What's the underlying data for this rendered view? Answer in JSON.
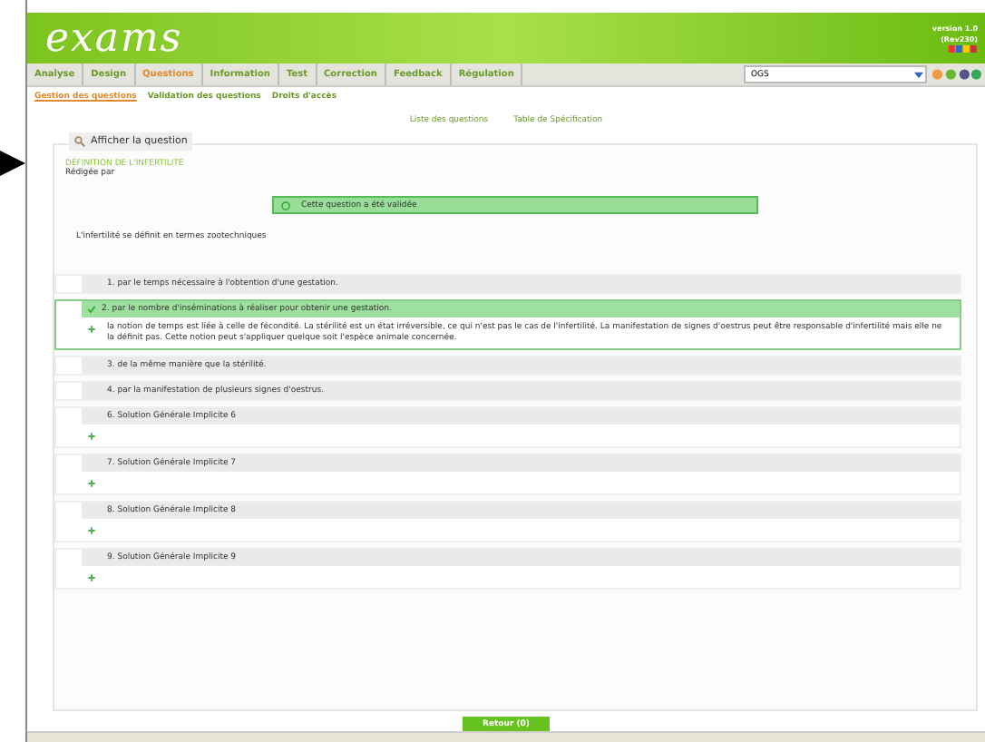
{
  "header": {
    "logo": "exams",
    "version": "version 1.0",
    "revision": "(Rev230)"
  },
  "nav": {
    "tabs": [
      {
        "label": "Analyse",
        "selected": false
      },
      {
        "label": "Design",
        "selected": false
      },
      {
        "label": "Questions",
        "selected": true
      },
      {
        "label": "Information",
        "selected": false
      },
      {
        "label": "Test",
        "selected": false
      },
      {
        "label": "Correction",
        "selected": false
      },
      {
        "label": "Feedback",
        "selected": false
      },
      {
        "label": "Régulation",
        "selected": false
      }
    ],
    "select_value": "OGS"
  },
  "subnav": [
    {
      "label": "Gestion des questions",
      "selected": true
    },
    {
      "label": "Validation des questions",
      "selected": false
    },
    {
      "label": "Droits d'accès",
      "selected": false
    }
  ],
  "links": [
    "Liste des questions",
    "Table de Spécification"
  ],
  "panel": {
    "legend": "Afficher la question",
    "title": "DÉFINITION DE L'INFERTILITÉ",
    "author": "Rédigée par",
    "status": "Cette question a été validée",
    "stem": "L'infertilité se définit en termes zootechniques",
    "answers": [
      {
        "text": "1. par le temps nécessaire à l'obtention d'une gestation.",
        "correct": false,
        "expandable": false
      },
      {
        "text": "2. par le nombre d'inséminations à réaliser pour obtenir une gestation.",
        "correct": true,
        "expandable": true,
        "feedback": "la notion de temps est liée à celle de fécondité. La stérilité est un état irréversible, ce qui n'est pas le cas de l'infertilité. La manifestation de signes d'oestrus peut être responsable d'infertilité mais elle ne la définit pas. Cette notion peut s'appliquer quelque soit l'espèce animale concernée."
      },
      {
        "text": "3. de la même manière que la stérilité.",
        "correct": false,
        "expandable": false
      },
      {
        "text": "4. par la manifestation de plusieurs signes d'oestrus.",
        "correct": false,
        "expandable": false
      },
      {
        "text": "6. Solution Générale Implicite 6",
        "correct": false,
        "expandable": true
      },
      {
        "text": "7. Solution Générale Implicite 7",
        "correct": false,
        "expandable": true
      },
      {
        "text": "8. Solution Générale Implicite 8",
        "correct": false,
        "expandable": true
      },
      {
        "text": "9. Solution Générale Implicite 9",
        "correct": false,
        "expandable": true
      }
    ]
  },
  "back_button": "Retour (0)"
}
